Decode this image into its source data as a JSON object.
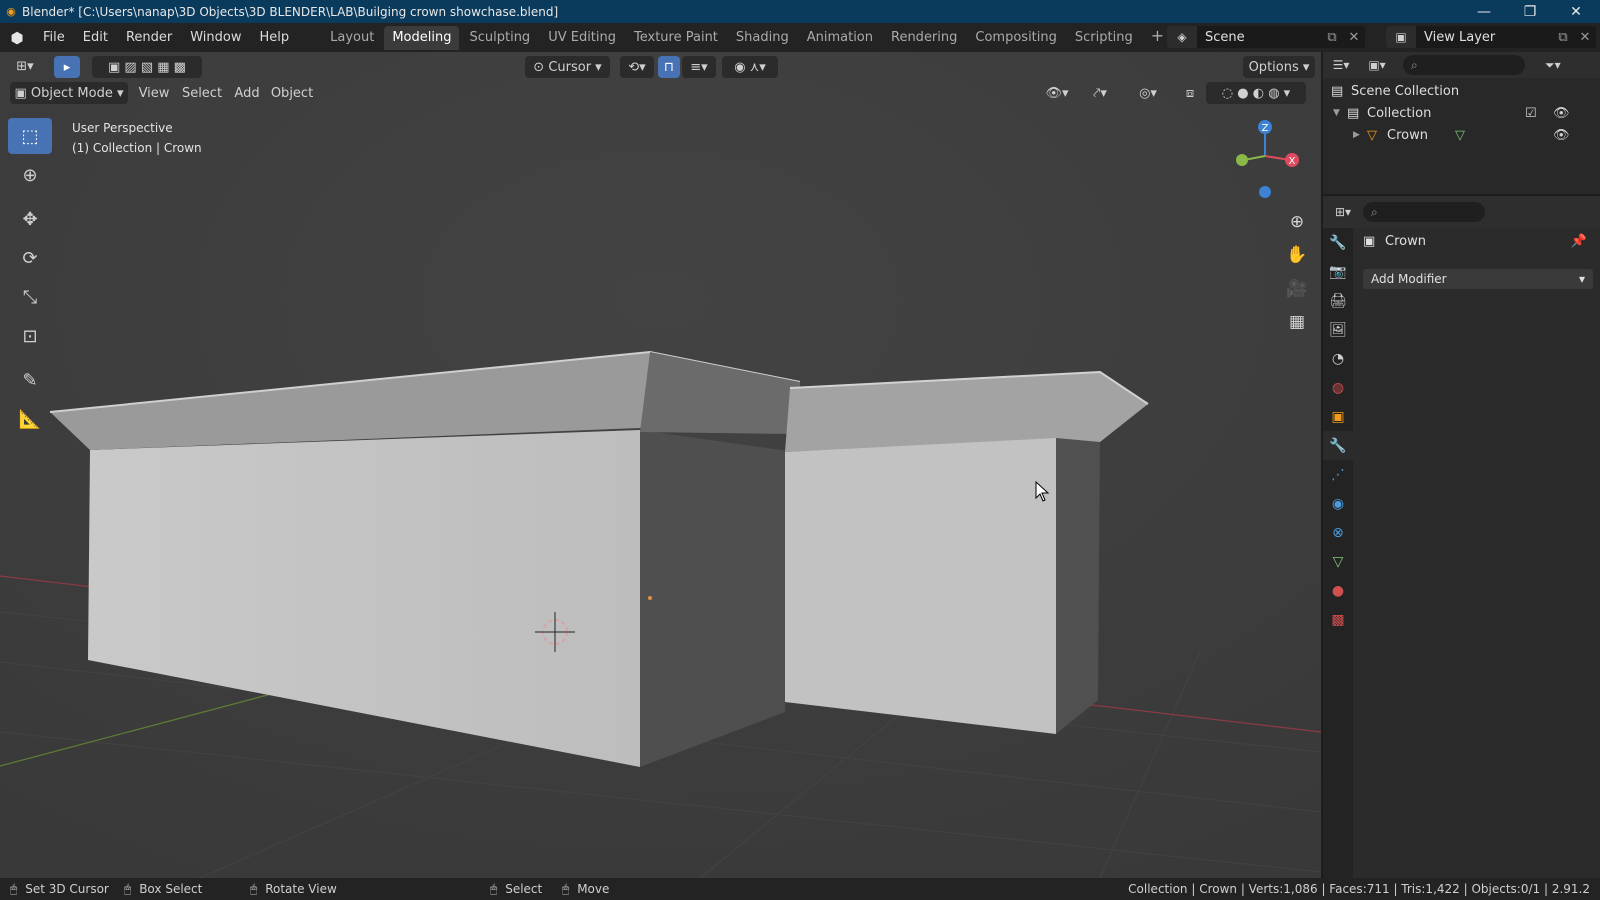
{
  "window": {
    "title": "Blender* [C:\\Users\\nanap\\3D Objects\\3D BLENDER\\LAB\\Builging crown showchase.blend]",
    "controls": [
      "minimize",
      "restore",
      "close"
    ]
  },
  "menu": {
    "items": [
      "File",
      "Edit",
      "Render",
      "Window",
      "Help"
    ]
  },
  "workspaces": {
    "tabs": [
      "Layout",
      "Modeling",
      "Sculpting",
      "UV Editing",
      "Texture Paint",
      "Shading",
      "Animation",
      "Rendering",
      "Compositing",
      "Scripting"
    ],
    "active": "Modeling",
    "add_symbol": "+"
  },
  "scene": {
    "label": "Scene"
  },
  "view_layer": {
    "label": "View Layer"
  },
  "viewport_header": {
    "pivot_label": "Cursor",
    "options_label": "Options",
    "mode_label": "Object Mode",
    "menus": [
      "View",
      "Select",
      "Add",
      "Object"
    ]
  },
  "viewport": {
    "perspective": "User Perspective",
    "context": "(1) Collection | Crown",
    "gizmo_axes": {
      "z": "Z",
      "x": "X"
    }
  },
  "outliner": {
    "scene_collection": "Scene Collection",
    "collection": "Collection",
    "object": "Crown"
  },
  "properties": {
    "object_name": "Crown",
    "add_modifier_label": "Add Modifier",
    "active_tab": "modifiers"
  },
  "statusbar": {
    "hints": [
      "Set 3D Cursor",
      "Box Select",
      "Rotate View",
      "Select",
      "Move"
    ],
    "stats": "Collection | Crown  | Verts:1,086 | Faces:711 | Tris:1,422 | Objects:0/1 | 2.91.2"
  },
  "colors": {
    "accent": "#4772b3",
    "title_bar": "#0a3a5c",
    "viewport_bg": "#3e3e3e",
    "axis_x": "#e04a5e",
    "axis_y": "#8ab84b",
    "axis_z": "#3e82d6"
  }
}
